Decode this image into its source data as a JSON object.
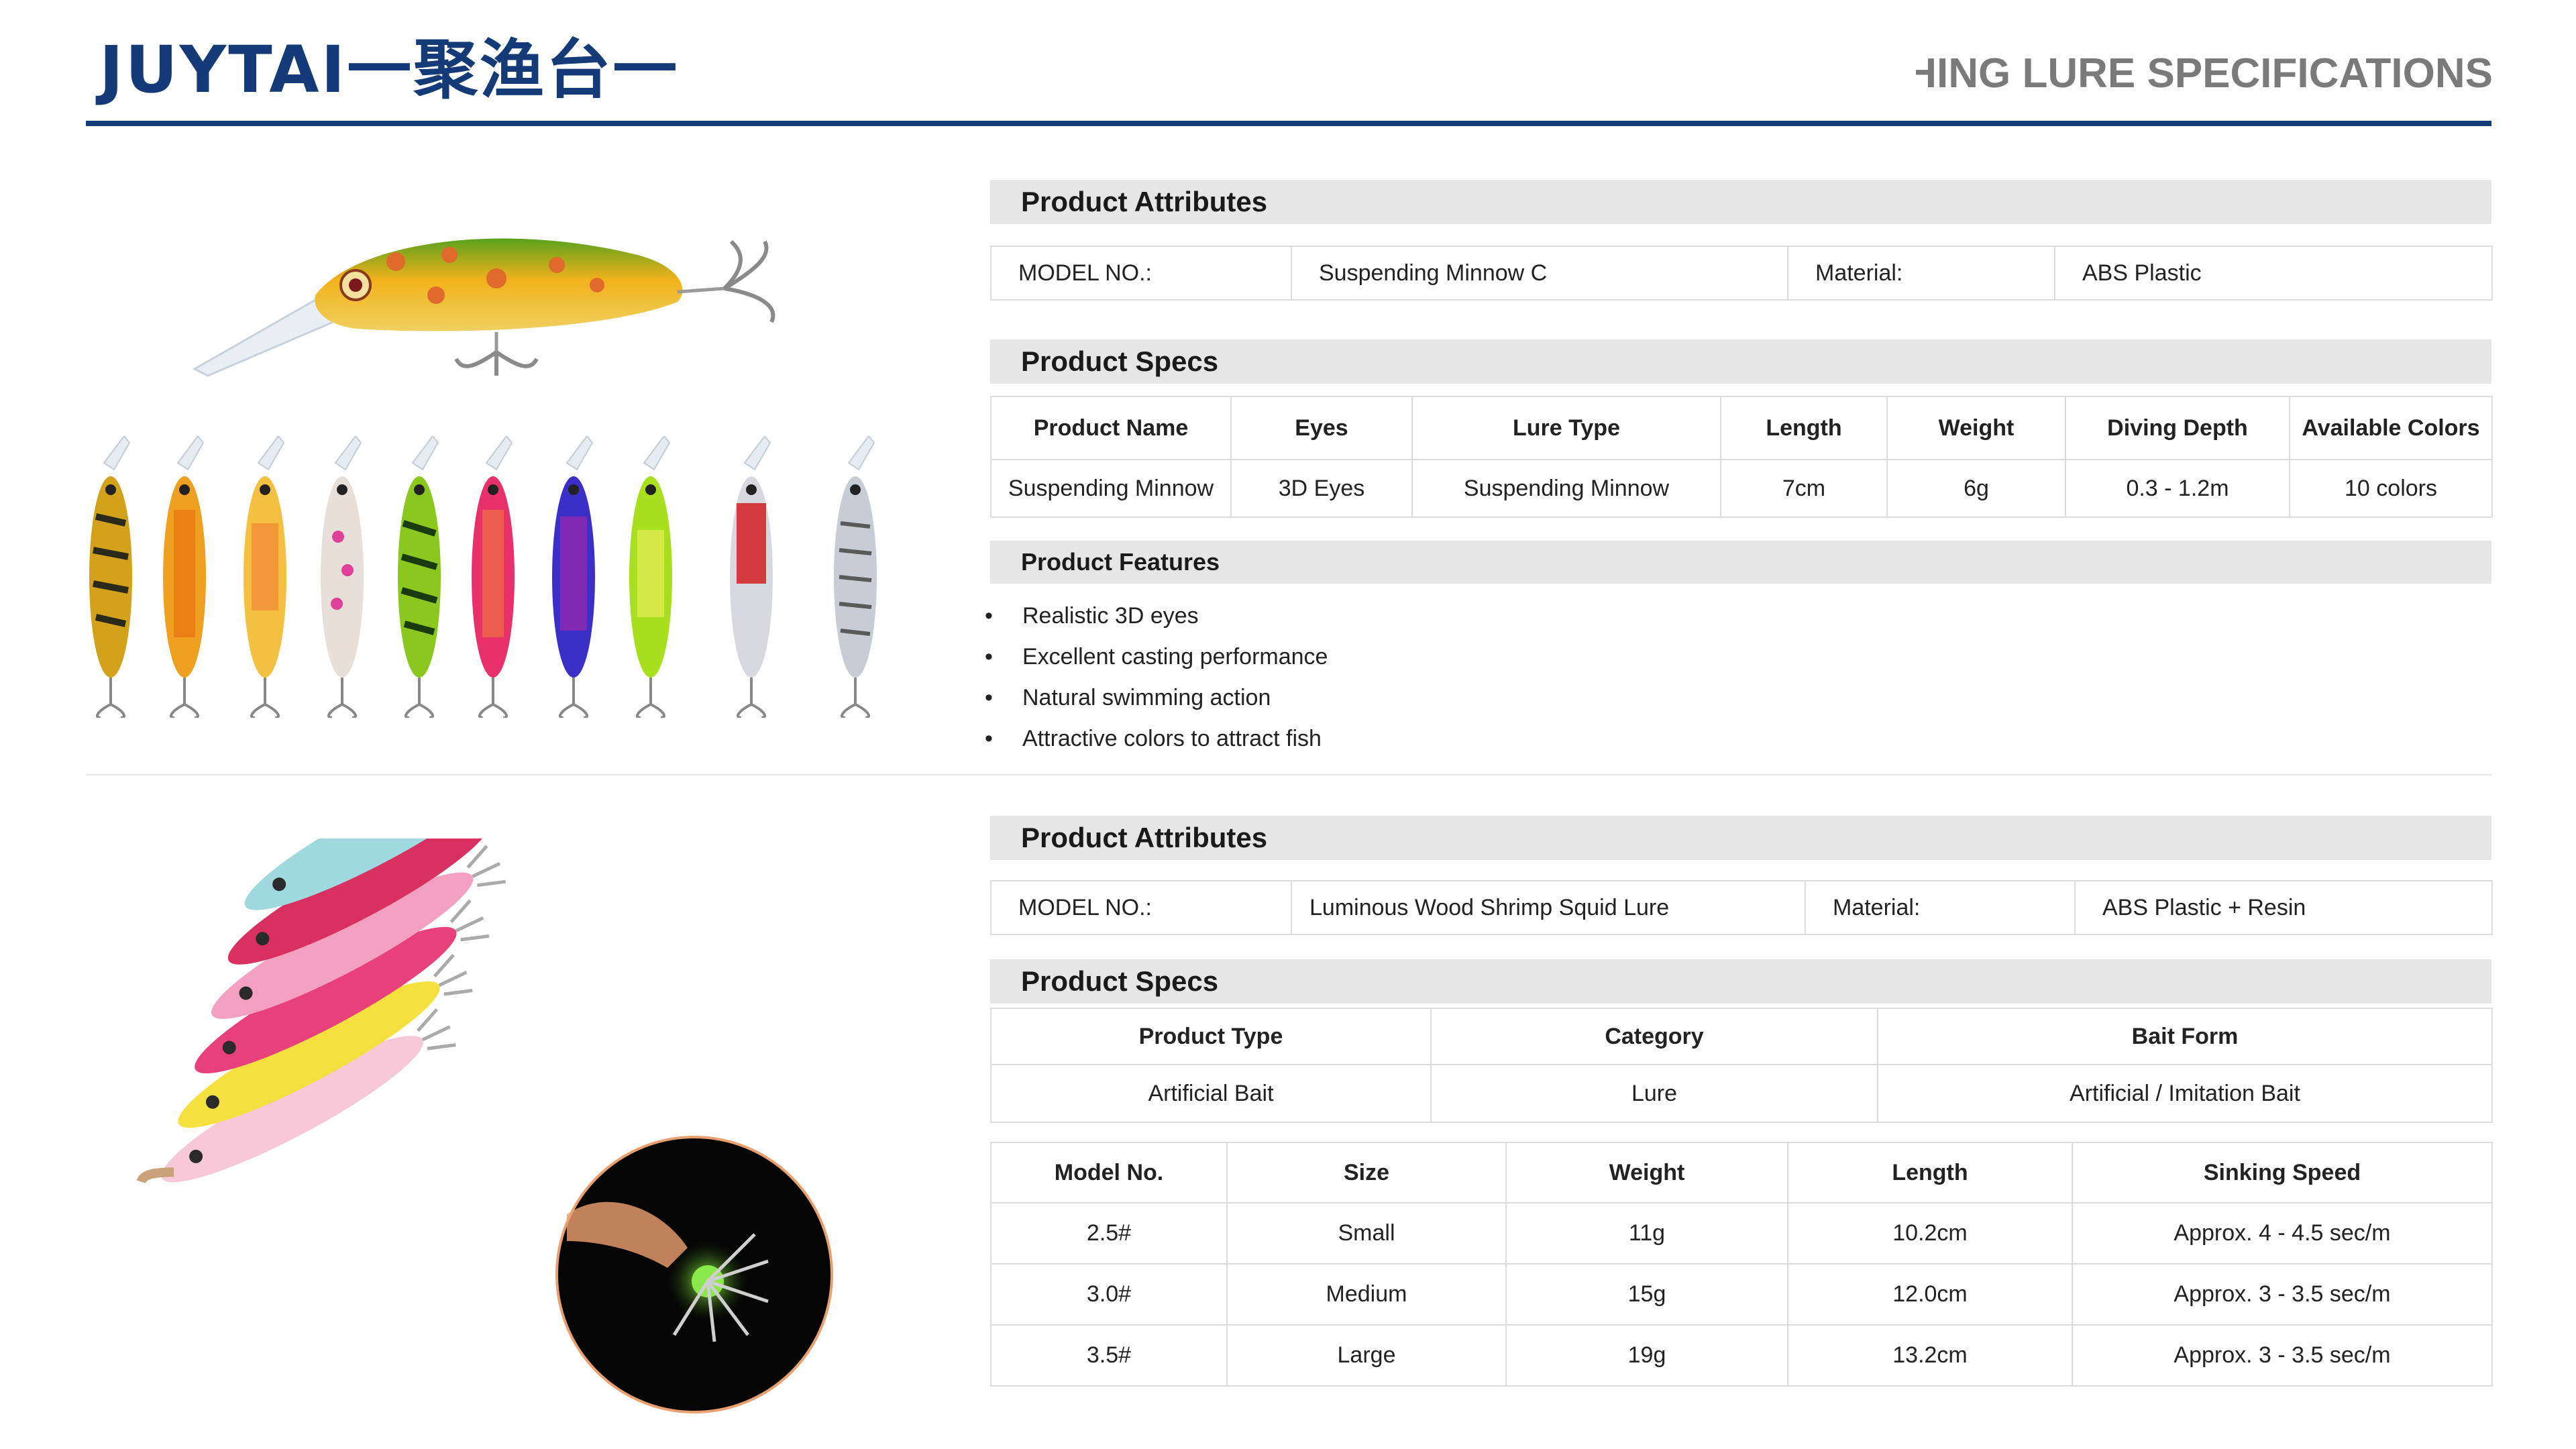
{
  "header": {
    "brand": "JUYTAI一聚渔台一",
    "doc_title": "FISHING LURE SPECIFICATIONS"
  },
  "colors": {
    "brand_blue": "#143a78",
    "bar_gray": "#e6e6e6",
    "border_gray": "#dcdcdc"
  },
  "section1": {
    "attributes_heading": "Product Attributes",
    "attributes": {
      "model_label": "MODEL NO.:",
      "model_value": "Suspending Minnow C",
      "material_label": "Material:",
      "material_value": "ABS Plastic"
    },
    "specs_heading": "Product Specs",
    "specs": {
      "headers": [
        "Product Name",
        "Eyes",
        "Lure Type",
        "Length",
        "Weight",
        "Diving Depth",
        "Available Colors"
      ],
      "row": [
        "Suspending Minnow",
        "3D Eyes",
        "Suspending Minnow",
        "7cm",
        "6g",
        "0.3 - 1.2m",
        "10 colors"
      ]
    },
    "features_heading": "Product Features",
    "features": [
      "Realistic 3D eyes",
      "Excellent casting performance",
      "Natural swimming action",
      "Attractive colors to attract fish"
    ]
  },
  "section2": {
    "attributes_heading": "Product Attributes",
    "attributes": {
      "model_label": "MODEL NO.:",
      "model_value": "Luminous Wood Shrimp Squid Lure",
      "material_label": "Material:",
      "material_value": "ABS Plastic + Resin"
    },
    "specs_heading": "Product Specs",
    "type_table": {
      "headers": [
        "Product Type",
        "Category",
        "Bait Form"
      ],
      "row": [
        "Artificial Bait",
        "Lure",
        "Artificial / Imitation Bait"
      ]
    },
    "size_table": {
      "headers": [
        "Model No.",
        "Size",
        "Weight",
        "Length",
        "Sinking Speed"
      ],
      "rows": [
        [
          "2.5#",
          "Small",
          "11g",
          "10.2cm",
          "Approx. 4 - 4.5 sec/m"
        ],
        [
          "3.0#",
          "Medium",
          "15g",
          "12.0cm",
          "Approx. 3 - 3.5 sec/m"
        ],
        [
          "3.5#",
          "Large",
          "19g",
          "13.2cm",
          "Approx. 3 - 3.5 sec/m"
        ]
      ]
    }
  }
}
